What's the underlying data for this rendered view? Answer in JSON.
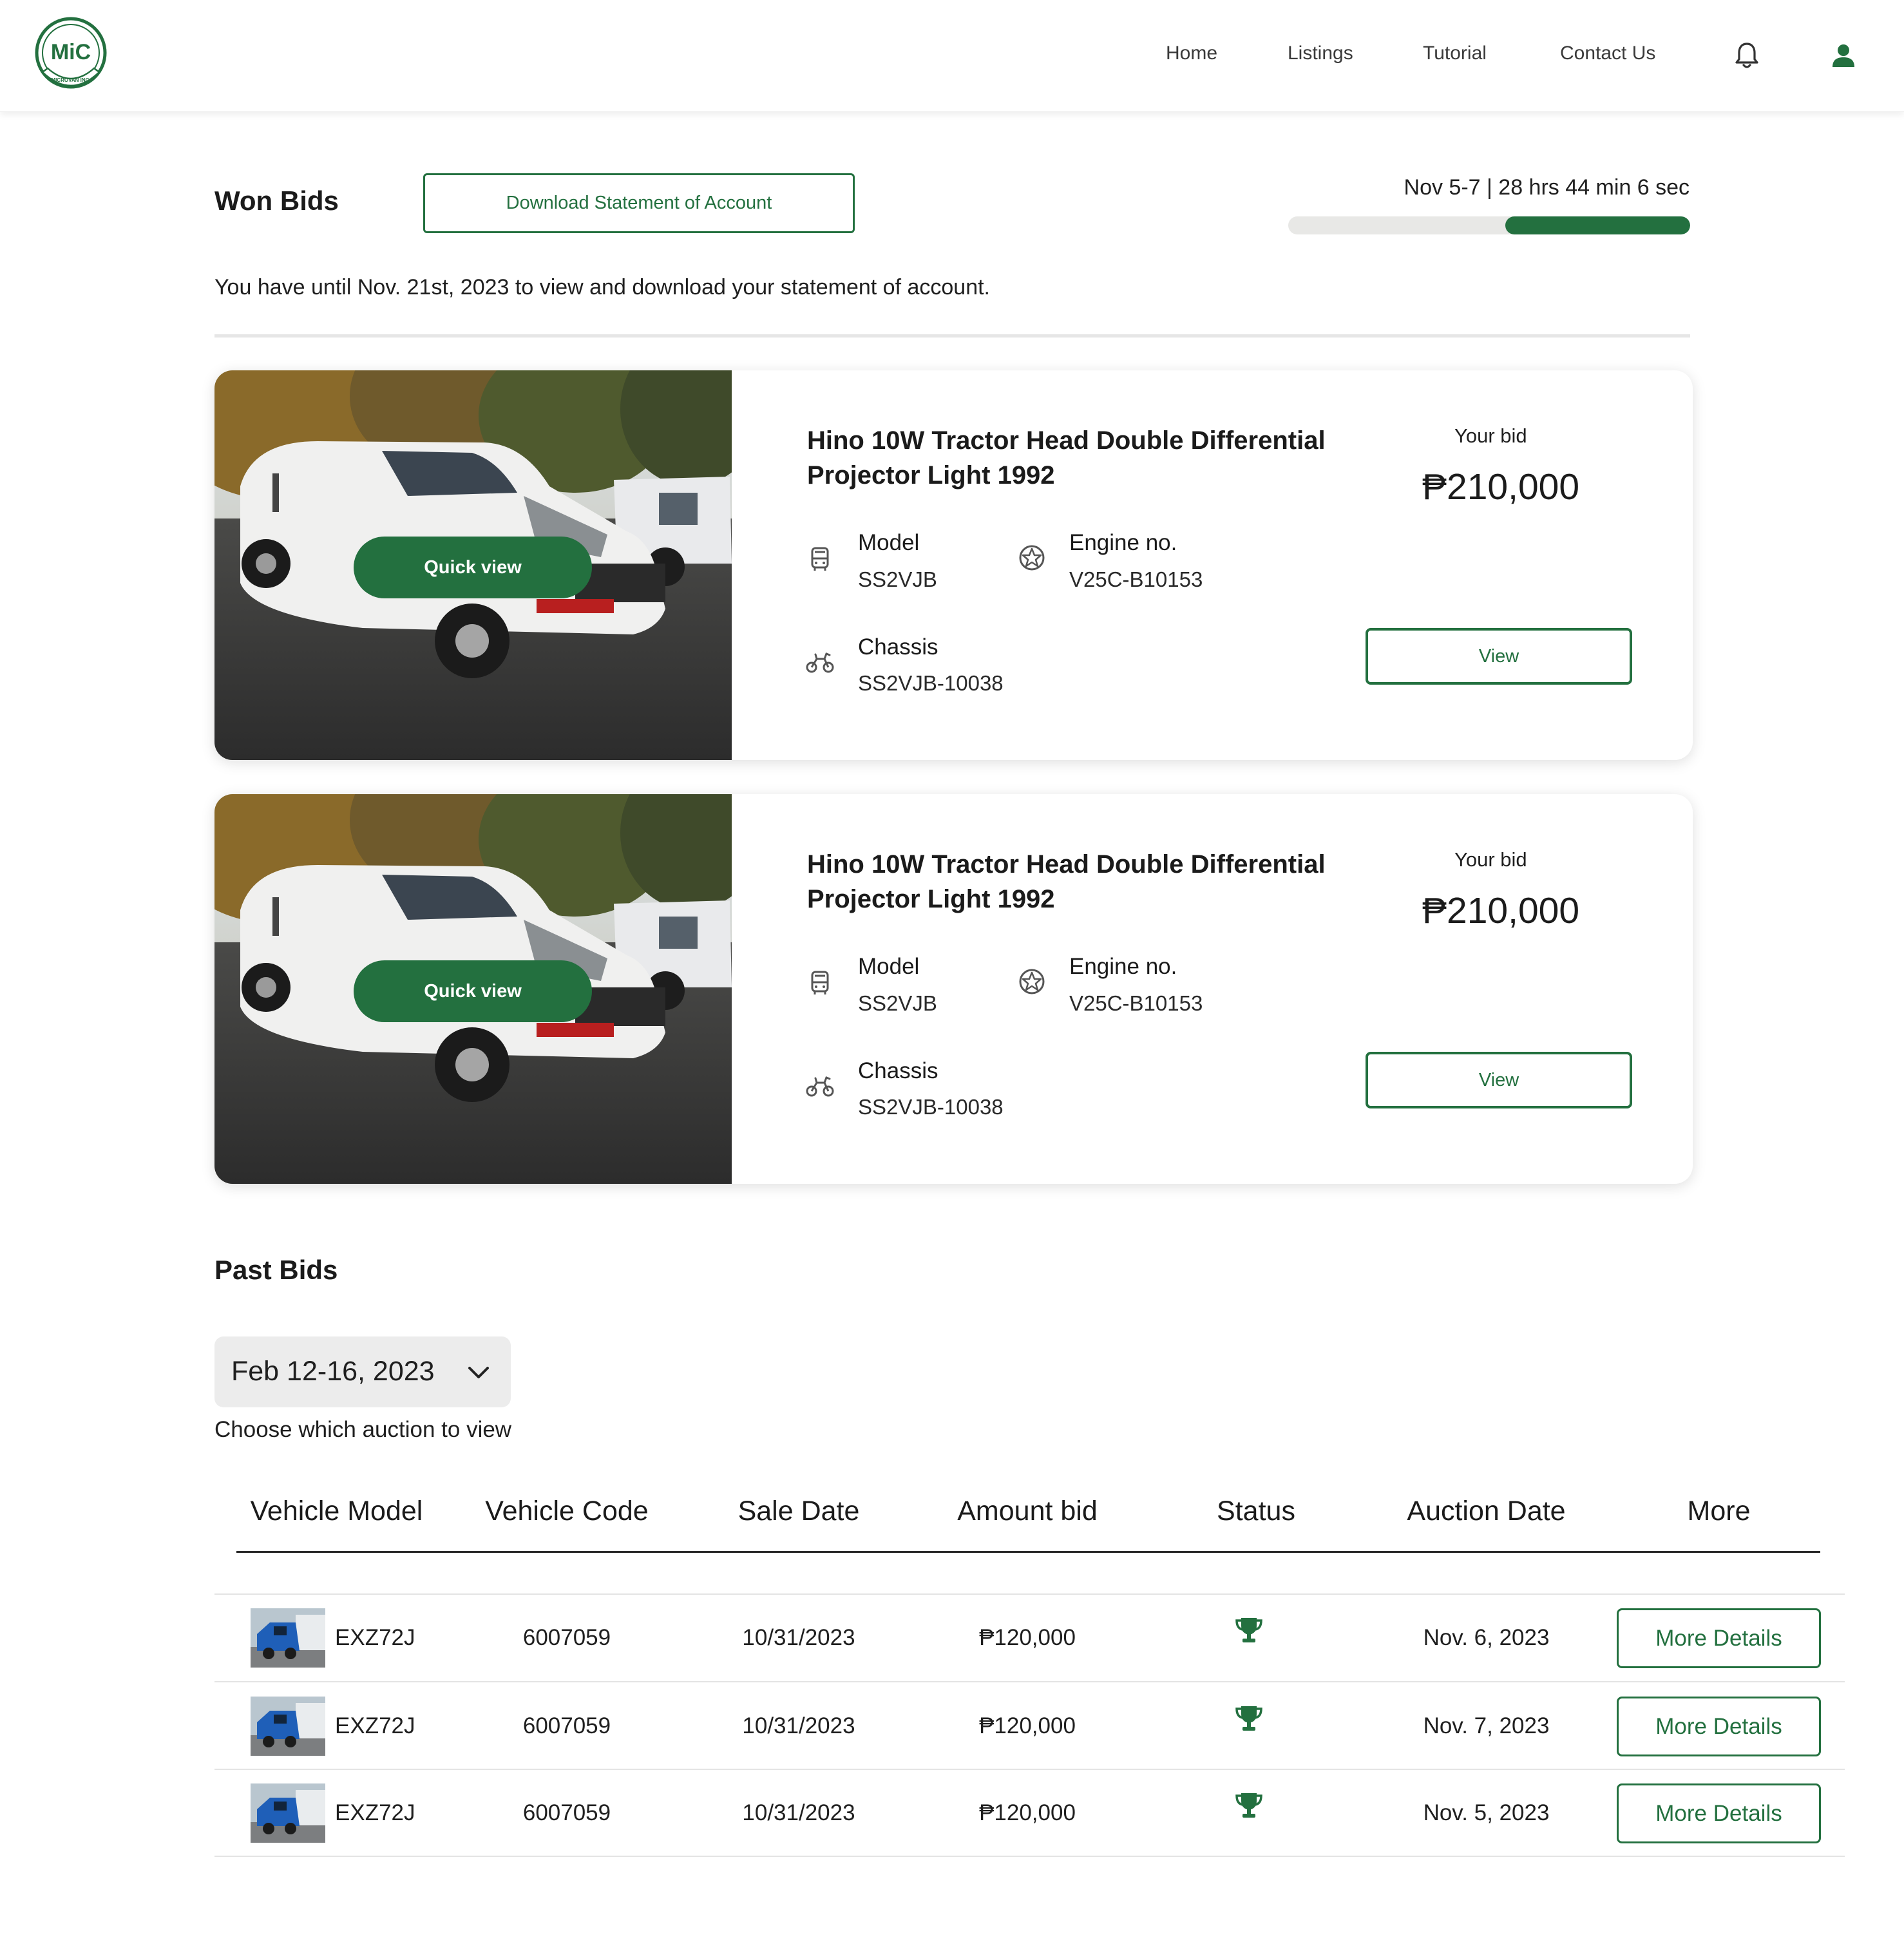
{
  "nav": {
    "links": [
      "Home",
      "Listings",
      "Tutorial",
      "Contact Us"
    ],
    "bell_icon": "bell-icon",
    "user_icon": "user-icon",
    "logo_text": "MiC",
    "logo_subtext": "MICROVAN INC."
  },
  "won_bids": {
    "title": "Won Bids",
    "download_label": "Download Statement of Account",
    "timer": "Nov 5-7 | 28 hrs 44 min 6 sec",
    "timer_progress": 0.46,
    "notice": "You have until Nov. 21st, 2023 to view and download your statement of account.",
    "cards": [
      {
        "title": "Hino 10W Tractor Head Double Differential Projector Light 1992",
        "quick_view": "Quick view",
        "model_label": "Model",
        "model": "SS2VJB",
        "engine_label": "Engine no.",
        "engine": "V25C-B10153",
        "chassis_label": "Chassis",
        "chassis": "SS2VJB-10038",
        "bid_label": "Your bid",
        "bid_amount": "₱210,000",
        "view_label": "View"
      },
      {
        "title": "Hino 10W Tractor Head Double Differential Projector Light 1992",
        "quick_view": "Quick view",
        "model_label": "Model",
        "model": "SS2VJB",
        "engine_label": "Engine no.",
        "engine": "V25C-B10153",
        "chassis_label": "Chassis",
        "chassis": "SS2VJB-10038",
        "bid_label": "Your bid",
        "bid_amount": "₱210,000",
        "view_label": "View"
      }
    ]
  },
  "past_bids": {
    "title": "Past Bids",
    "selected_auction": "Feb 12-16, 2023",
    "help": "Choose which auction to view",
    "columns": [
      "Vehicle Model",
      "Vehicle Code",
      "Sale Date",
      "Amount bid",
      "Status",
      "Auction Date",
      "More"
    ],
    "rows": [
      {
        "model": "EXZ72J",
        "code": "6007059",
        "sale_date": "10/31/2023",
        "amount": "₱120,000",
        "status_icon": "trophy-icon",
        "auction_date": "Nov. 6, 2023",
        "more": "More Details"
      },
      {
        "model": "EXZ72J",
        "code": "6007059",
        "sale_date": "10/31/2023",
        "amount": "₱120,000",
        "status_icon": "trophy-icon",
        "auction_date": "Nov. 7, 2023",
        "more": "More Details"
      },
      {
        "model": "EXZ72J",
        "code": "6007059",
        "sale_date": "10/31/2023",
        "amount": "₱120,000",
        "status_icon": "trophy-icon",
        "auction_date": "Nov. 5, 2023",
        "more": "More Details"
      }
    ]
  },
  "colors": {
    "brand_green": "#23703f",
    "progress_track": "#e8e8e6"
  }
}
